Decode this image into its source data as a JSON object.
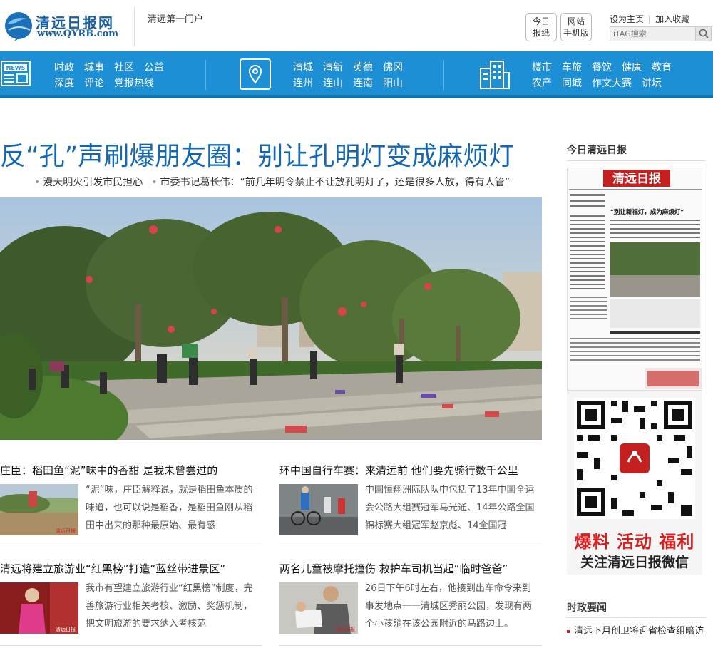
{
  "header": {
    "logo_name": "清远日报网",
    "logo_url": "www.QYRB.com",
    "slogan": "清远第一门户",
    "btn_paper": [
      "今日",
      "报纸"
    ],
    "btn_mobile": [
      "网站",
      "手机版"
    ],
    "set_home": "设为主页",
    "add_fav": "加入收藏",
    "search_placeholder": "iTAG搜索"
  },
  "nav": {
    "group1": {
      "icon": "newspaper-icon",
      "row1": [
        "时政",
        "城事",
        "社区",
        "公益"
      ],
      "row2": [
        "深度",
        "评论",
        "党报热线"
      ]
    },
    "group2": {
      "icon": "location-pin-icon",
      "row1": [
        "清城",
        "清新",
        "英德",
        "佛冈"
      ],
      "row2": [
        "连州",
        "连山",
        "连南",
        "阳山"
      ]
    },
    "group3": {
      "icon": "buildings-icon",
      "row1": [
        "楼市",
        "车旅",
        "餐饮",
        "健康",
        "教育"
      ],
      "row2": [
        "农产",
        "同城",
        "作文大赛",
        "讲坛"
      ]
    }
  },
  "main": {
    "headline": "反“孔”声刷爆朋友圈：别让孔明灯变成麻烦灯",
    "sub1": "漫天明火引发市民担心",
    "sub2": "市委书记葛长伟：“前几年明令禁止不让放孔明灯了，还是很多人放，得有人管”",
    "stories": [
      {
        "title": "庄臣：稻田鱼“泥”味中的香甜 是我未曾尝过的",
        "text": "“泥”味，庄臣解释说，就是稻田鱼本质的味道，也可以说是稻香，是稻田鱼刚从稻田中出来的那种最原始、最有感"
      },
      {
        "title": "环中国自行车赛：来清远前 他们要先骑行数千公里",
        "text": "中国恒翔洲际队队中包括了13年中国全运会公路大组赛冠军马光通、14年公路全国锦标赛大组冠军赵京彪、14全国冠"
      },
      {
        "title": "清远将建立旅游业“红黑榜”打造“蓝丝带进景区”",
        "text": "我市有望建立旅游行业“红黑榜”制度，完善旅游行业相关考核、激励、奖惩机制，把文明旅游的要求纳入考核范"
      },
      {
        "title": "两名儿童被摩托撞伤 救护车司机当起“临时爸爸”",
        "text": "26日下午6时左右，他接到出车命令来到事发地点一一清城区秀丽公园，发现有两个小孩躺在该公园附近的马路边上。"
      }
    ]
  },
  "sidebar": {
    "paper_title": "今日清远日报",
    "paper_masthead": "清远日报",
    "paper_headline": "“别让新福灯，成为麻烦灯”",
    "qr_line1": "爆料 活动 福利",
    "qr_line2": "关注清远日报微信",
    "news_title": "时政要闻",
    "news_item": "清远下月创卫将迎省检查组暗访"
  },
  "colors": {
    "brand_blue": "#1d8fd4",
    "headline_blue": "#1467b4",
    "accent_red": "#d92020"
  }
}
